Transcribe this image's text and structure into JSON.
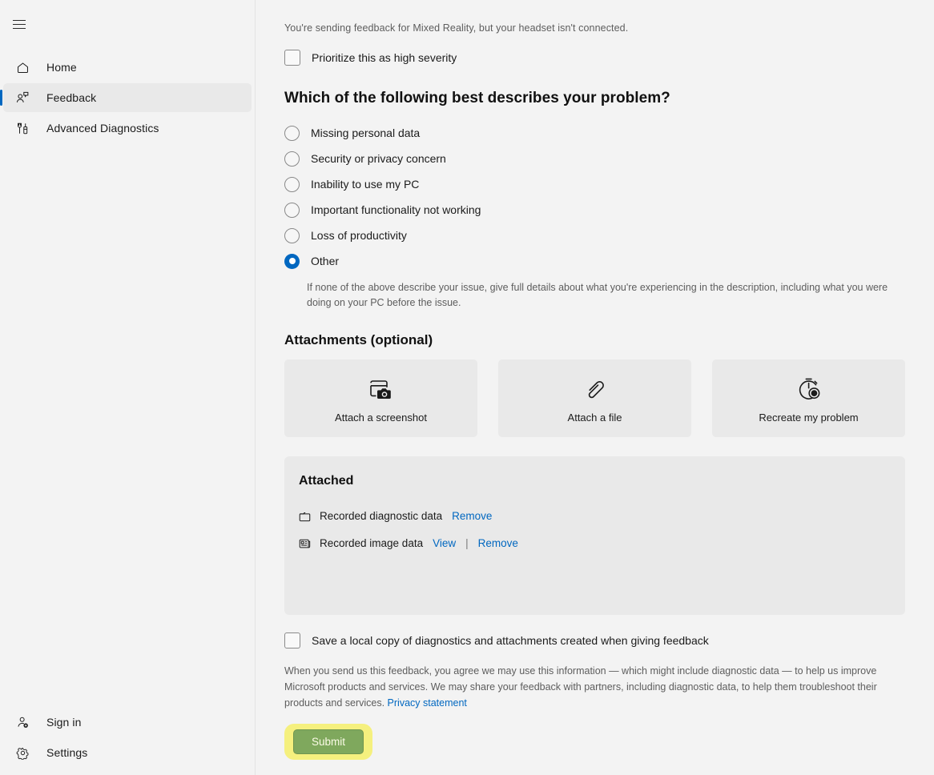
{
  "sidebar": {
    "menu_button": "hamburger-menu",
    "items": [
      {
        "id": "home",
        "label": "Home",
        "icon": "home-icon",
        "selected": false
      },
      {
        "id": "feedback",
        "label": "Feedback",
        "icon": "feedback-icon",
        "selected": true
      },
      {
        "id": "advanced-diagnostics",
        "label": "Advanced Diagnostics",
        "icon": "tools-icon",
        "selected": false
      }
    ],
    "bottom_items": [
      {
        "id": "sign-in",
        "label": "Sign in",
        "icon": "person-add-icon"
      },
      {
        "id": "settings",
        "label": "Settings",
        "icon": "gear-icon"
      }
    ]
  },
  "main": {
    "notice": "You're sending feedback for Mixed Reality, but your headset isn't connected.",
    "severity_checkbox": {
      "label": "Prioritize this as high severity",
      "checked": false
    },
    "problem_section": {
      "heading": "Which of the following best describes your problem?",
      "options": [
        {
          "id": "missing-personal-data",
          "label": "Missing personal data",
          "selected": false
        },
        {
          "id": "security-or-privacy-concern",
          "label": "Security or privacy concern",
          "selected": false
        },
        {
          "id": "inability-to-use-my-pc",
          "label": "Inability to use my PC",
          "selected": false
        },
        {
          "id": "important-functionality-not-working",
          "label": "Important functionality not working",
          "selected": false
        },
        {
          "id": "loss-of-productivity",
          "label": "Loss of productivity",
          "selected": false
        },
        {
          "id": "other",
          "label": "Other",
          "selected": true
        }
      ],
      "other_help": "If none of the above describe your issue, give full details about what you're experiencing in the description, including what you were doing on your PC before the issue."
    },
    "attachments": {
      "heading": "Attachments (optional)",
      "cards": [
        {
          "id": "attach-a-screenshot",
          "label": "Attach a screenshot",
          "icon": "screenshot-icon"
        },
        {
          "id": "attach-a-file",
          "label": "Attach a file",
          "icon": "paperclip-icon"
        },
        {
          "id": "recreate-my-problem",
          "label": "Recreate my problem",
          "icon": "record-stopwatch-icon"
        }
      ]
    },
    "attached": {
      "title": "Attached",
      "items": [
        {
          "id": "recorded-diagnostic-data",
          "name": "Recorded diagnostic data",
          "icon": "folder-icon",
          "view_label": null,
          "remove_label": "Remove"
        },
        {
          "id": "recorded-image-data",
          "name": "Recorded image data",
          "icon": "image-data-icon",
          "view_label": "View",
          "separator": "|",
          "remove_label": "Remove"
        }
      ]
    },
    "save_local_checkbox": {
      "label": "Save a local copy of diagnostics and attachments created when giving feedback",
      "checked": false
    },
    "legal": {
      "text": "When you send us this feedback, you agree we may use this information — which might include diagnostic data — to help us improve Microsoft products and services. We may share your feedback with partners, including diagnostic data, to help them troubleshoot their products and services. ",
      "link_label": "Privacy statement"
    },
    "submit_button": {
      "label": "Submit",
      "highlighted": true
    }
  },
  "colors": {
    "page_background": "#f3f3f3",
    "panel_background": "#e9e9e9",
    "accent_blue": "#0067c0",
    "link_blue": "#0067c0",
    "submit_green": "#7fa85d",
    "highlight_yellow": "#f5f07e",
    "text_primary": "#1b1b1b",
    "text_secondary": "#5d5d5d"
  }
}
